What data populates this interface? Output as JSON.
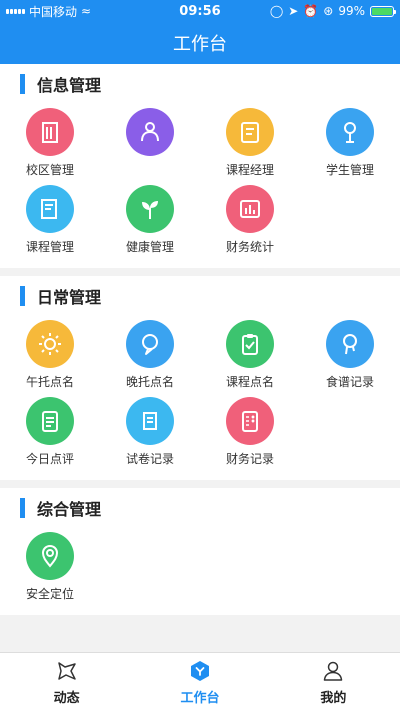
{
  "status_bar": {
    "carrier": "中国移动",
    "time": "09:56",
    "battery": "99%",
    "battery_level": 0.99
  },
  "nav": {
    "title": "工作台"
  },
  "sections": [
    {
      "title": "信息管理",
      "items": [
        {
          "label": "校区管理",
          "color": "#f0607a",
          "icon": "building-icon"
        },
        {
          "label": "",
          "color": "#8a5ee8",
          "icon": "people-network-icon"
        },
        {
          "label": "课程经理",
          "color": "#f6b93a",
          "icon": "course-manager-icon"
        },
        {
          "label": "学生管理",
          "color": "#3aa3f0",
          "icon": "student-icon"
        },
        {
          "label": "课程管理",
          "color": "#3cb8f0",
          "icon": "book-edit-icon"
        },
        {
          "label": "健康管理",
          "color": "#3cc46f",
          "icon": "sprout-icon"
        },
        {
          "label": "财务统计",
          "color": "#f0607a",
          "icon": "finance-chart-icon"
        }
      ]
    },
    {
      "title": "日常管理",
      "items": [
        {
          "label": "午托点名",
          "color": "#f6b93a",
          "icon": "sun-icon"
        },
        {
          "label": "晚托点名",
          "color": "#3aa3f0",
          "icon": "moon-bubble-icon"
        },
        {
          "label": "课程点名",
          "color": "#3cc46f",
          "icon": "clipboard-icon"
        },
        {
          "label": "食谱记录",
          "color": "#3aa3f0",
          "icon": "recipe-icon"
        },
        {
          "label": "今日点评",
          "color": "#3cc46f",
          "icon": "document-icon"
        },
        {
          "label": "试卷记录",
          "color": "#3cb8f0",
          "icon": "scroll-icon"
        },
        {
          "label": "财务记录",
          "color": "#f0607a",
          "icon": "ledger-icon"
        }
      ]
    },
    {
      "title": "综合管理",
      "items": [
        {
          "label": "安全定位",
          "color": "#3cc46f",
          "icon": "location-pin-icon"
        }
      ]
    }
  ],
  "tabbar": {
    "items": [
      {
        "label": "动态",
        "icon": "star-bubble-icon",
        "active": false
      },
      {
        "label": "工作台",
        "icon": "workbench-icon",
        "active": true
      },
      {
        "label": "我的",
        "icon": "profile-icon",
        "active": false
      }
    ]
  }
}
